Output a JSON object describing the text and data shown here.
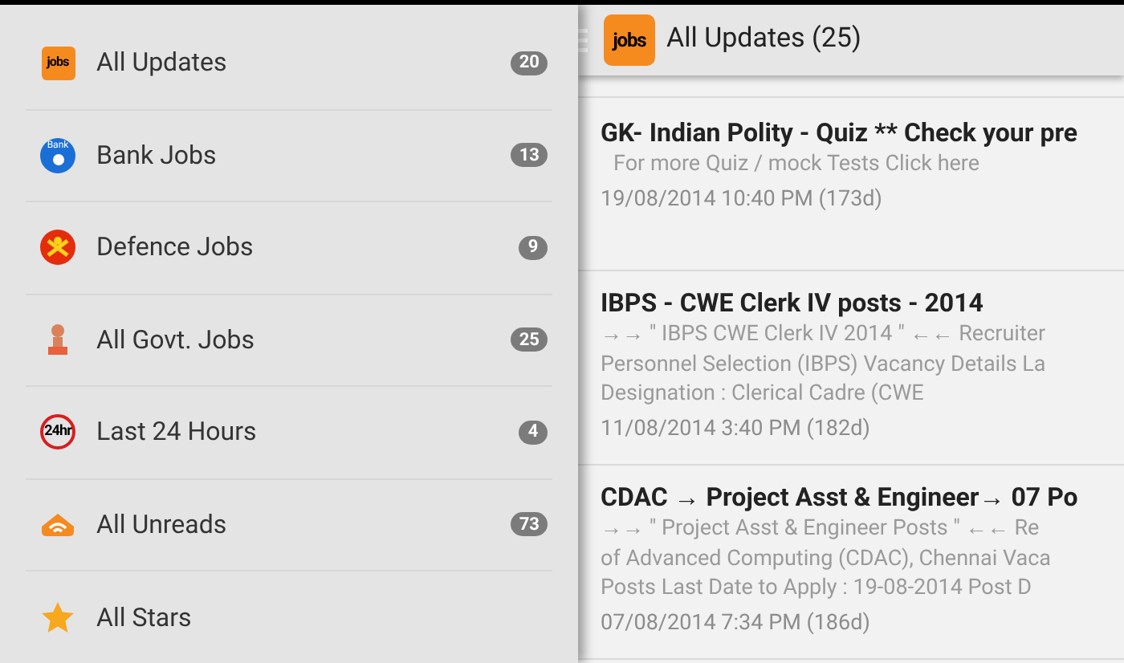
{
  "drawer": {
    "items": [
      {
        "label": "All Updates",
        "count": "20",
        "icon_text": "jobs"
      },
      {
        "label": "Bank Jobs",
        "count": "13",
        "icon_text": "Bank"
      },
      {
        "label": "Defence Jobs",
        "count": "9"
      },
      {
        "label": "All Govt. Jobs",
        "count": "25"
      },
      {
        "label": "Last 24 Hours",
        "count": "4",
        "icon_text": "24hr"
      },
      {
        "label": "All Unreads",
        "count": "73"
      },
      {
        "label": "All Stars"
      }
    ]
  },
  "action_bar": {
    "logo_text": "jobs",
    "title": "All Updates (25)"
  },
  "posts": [
    {
      "title": "GK- Indian Polity - Quiz ** Check your pre",
      "lines": [
        "For more Quiz / mock Tests Click here"
      ],
      "date": "19/08/2014 10:40 PM (173d)"
    },
    {
      "title": "IBPS - CWE Clerk IV posts - 2014",
      "lines": [
        "→→ \" IBPS CWE Clerk IV 2014 \" ←← Recruiter",
        "Personnel Selection (IBPS)  Vacancy Details La",
        "Designation :  Clerical Cadre (CWE"
      ],
      "date": "11/08/2014 3:40 PM (182d)"
    },
    {
      "title": "CDAC → Project Asst & Engineer→ 07 Po",
      "lines": [
        "→→ \" Project Asst & Engineer Posts \" ←← Re",
        "of Advanced Computing (CDAC), Chennai Vaca",
        "Posts Last Date to Apply :  19-08-2014 Post D"
      ],
      "date": "07/08/2014 7:34 PM (186d)"
    }
  ]
}
